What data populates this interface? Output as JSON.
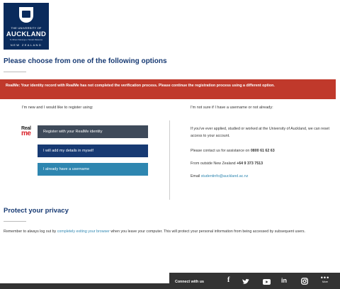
{
  "logo": {
    "line1": "THE UNIVERSITY OF",
    "line2": "AUCKLAND",
    "line3": "Te Whare Wānanga o Tāmaki Makaurau",
    "line4": "NEW ZEALAND"
  },
  "page": {
    "title": "Please choose from one of the following options"
  },
  "alert": {
    "message": "RealMe: Your identity record with RealMe has not completed the verification process. Please continue the registration process using a different option."
  },
  "left_column": {
    "label": "I'm new and I would like to register using:",
    "realme_logo_top": "Real",
    "realme_logo_bottom": "me",
    "buttons": {
      "realme": "Register with your RealMe identity",
      "details": "I will add my details in myself",
      "username": "I already have a username"
    }
  },
  "right_column": {
    "label": "I'm not sure if I have a username or not already:",
    "text1": "If you've ever applied, studied or worked at the University of Auckland, we can reset access to your account.",
    "contact_prefix": "Please contact us for assistance on",
    "contact_phone": "0800 61 62 63",
    "outside_prefix": "From outside New Zealand",
    "outside_phone": "+64 9 373 7513",
    "email_prefix": "Email",
    "email": "studentinfo@auckland.ac.nz"
  },
  "privacy": {
    "title": "Protect your privacy",
    "text_before": "Remember to always log out by",
    "link": "completely exiting your browser",
    "text_after": "when you leave your computer. This will protect your personal information from being accessed by subsequent users."
  },
  "footer": {
    "connect": "Connect with us",
    "more_label": "More",
    "icons": [
      "facebook-icon",
      "twitter-icon",
      "youtube-icon",
      "linkedin-icon",
      "instagram-icon"
    ]
  },
  "colors": {
    "navy": "#173a73",
    "alert_red": "#c0392b",
    "realme_button": "#3e4a5a",
    "teal_button": "#2e86b0",
    "footer": "#333333"
  }
}
